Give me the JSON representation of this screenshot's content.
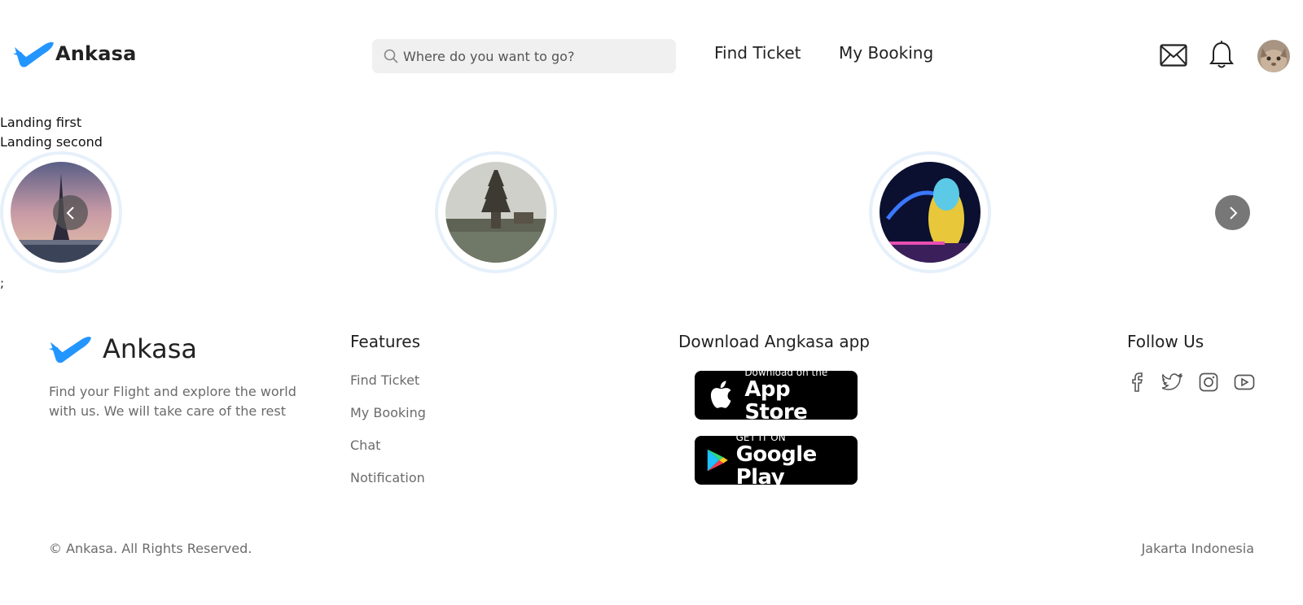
{
  "header": {
    "brand": "Ankasa",
    "search_placeholder": "Where do you want to go?",
    "nav": {
      "find_ticket": "Find Ticket",
      "my_booking": "My Booking"
    }
  },
  "landing": {
    "line1": "Landing first",
    "line2": "Landing second",
    "destinations": [
      "paris-eiffel-tower",
      "bali-temple",
      "singapore-merlion"
    ],
    "trailing": ";"
  },
  "footer": {
    "brand": "Ankasa",
    "description": "Find your Flight and explore the world with us. We will take care of the rest",
    "features_title": "Features",
    "features": [
      "Find Ticket",
      "My Booking",
      "Chat",
      "Notification"
    ],
    "download_title": "Download Angkasa app",
    "app_store": {
      "small": "Download on the",
      "big": "App Store"
    },
    "google_play": {
      "small": "GET IT ON",
      "big": "Google Play"
    },
    "follow_title": "Follow Us",
    "social": [
      "facebook-icon",
      "twitter-icon",
      "instagram-icon",
      "youtube-icon"
    ],
    "copyright": "© Ankasa. All Rights Reserved.",
    "location": "Jakarta Indonesia"
  },
  "colors": {
    "brand_blue": "#2395FF",
    "muted_text": "#6b6b6b",
    "search_bg": "#f0f0f0"
  }
}
